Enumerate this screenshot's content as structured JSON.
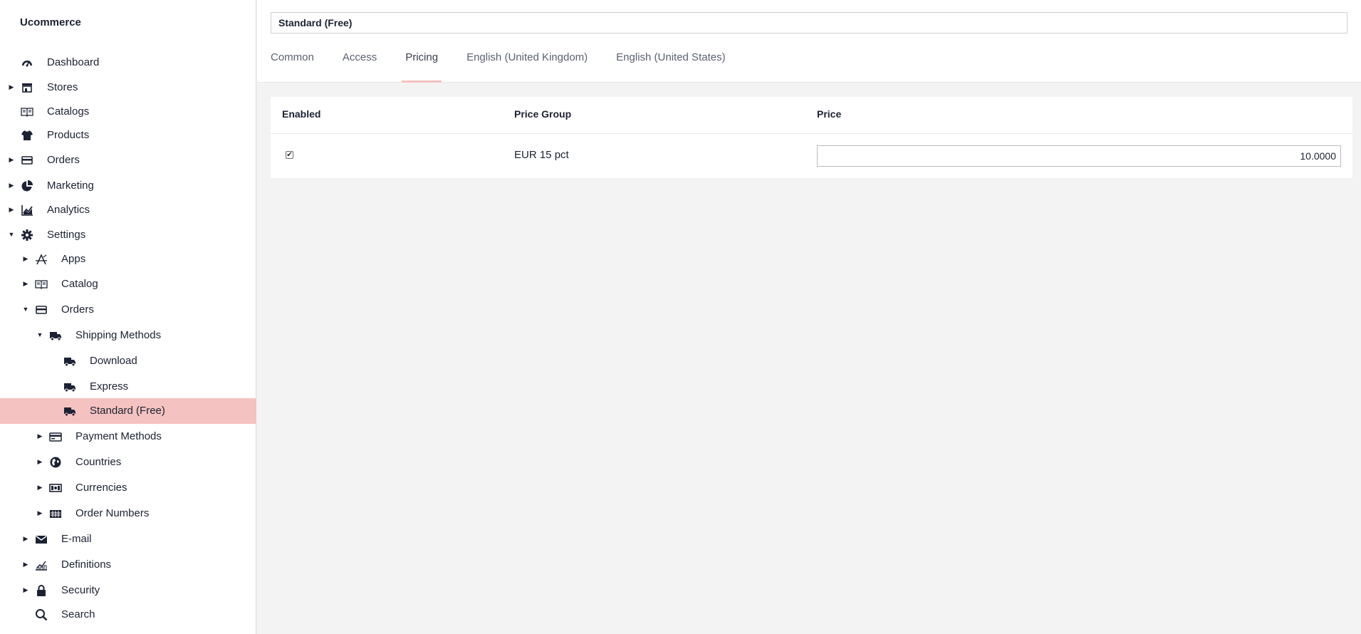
{
  "app": {
    "brand": "Ucommerce"
  },
  "sidebar": {
    "items": [
      {
        "label": "Dashboard",
        "icon": "dashboard-icon",
        "arrow": ""
      },
      {
        "label": "Stores",
        "icon": "store-icon",
        "arrow": "▶"
      },
      {
        "label": "Catalogs",
        "icon": "book-icon",
        "arrow": ""
      },
      {
        "label": "Products",
        "icon": "shirt-icon",
        "arrow": ""
      },
      {
        "label": "Orders",
        "icon": "card-icon",
        "arrow": "▶"
      },
      {
        "label": "Marketing",
        "icon": "pie-chart-icon",
        "arrow": "▶"
      },
      {
        "label": "Analytics",
        "icon": "line-chart-icon",
        "arrow": "▶"
      },
      {
        "label": "Settings",
        "icon": "gear-icon",
        "arrow": "▼"
      },
      {
        "label": "Apps",
        "icon": "apps-icon",
        "arrow": "▶"
      },
      {
        "label": "Catalog",
        "icon": "book-icon",
        "arrow": "▶"
      },
      {
        "label": "Orders",
        "icon": "card-icon",
        "arrow": "▼"
      },
      {
        "label": "Shipping Methods",
        "icon": "truck-icon",
        "arrow": "▼"
      },
      {
        "label": "Download",
        "icon": "truck-icon",
        "arrow": ""
      },
      {
        "label": "Express",
        "icon": "truck-icon",
        "arrow": ""
      },
      {
        "label": "Standard (Free)",
        "icon": "truck-icon",
        "arrow": ""
      },
      {
        "label": "Payment Methods",
        "icon": "credit-card-icon",
        "arrow": "▶"
      },
      {
        "label": "Countries",
        "icon": "globe-icon",
        "arrow": "▶"
      },
      {
        "label": "Currencies",
        "icon": "money-icon",
        "arrow": "▶"
      },
      {
        "label": "Order Numbers",
        "icon": "grid-icon",
        "arrow": "▶"
      },
      {
        "label": "E-mail",
        "icon": "envelope-icon",
        "arrow": "▶"
      },
      {
        "label": "Definitions",
        "icon": "definitions-icon",
        "arrow": "▶"
      },
      {
        "label": "Security",
        "icon": "lock-icon",
        "arrow": "▶"
      },
      {
        "label": "Search",
        "icon": "search-icon",
        "arrow": ""
      }
    ]
  },
  "editor": {
    "name_value": "Standard (Free)",
    "tabs": [
      {
        "label": "Common"
      },
      {
        "label": "Access"
      },
      {
        "label": "Pricing"
      },
      {
        "label": "English (United Kingdom)"
      },
      {
        "label": "English (United States)"
      }
    ],
    "active_tab": "Pricing"
  },
  "pricing_table": {
    "headers": {
      "enabled": "Enabled",
      "price_group": "Price Group",
      "price": "Price"
    },
    "rows": [
      {
        "enabled": true,
        "check_glyph": "✔",
        "price_group": "EUR 15 pct",
        "price": "10.0000"
      }
    ]
  },
  "colors": {
    "accent": "#f4c2c0",
    "text": "#1c2233",
    "background": "#f4f3f3"
  }
}
